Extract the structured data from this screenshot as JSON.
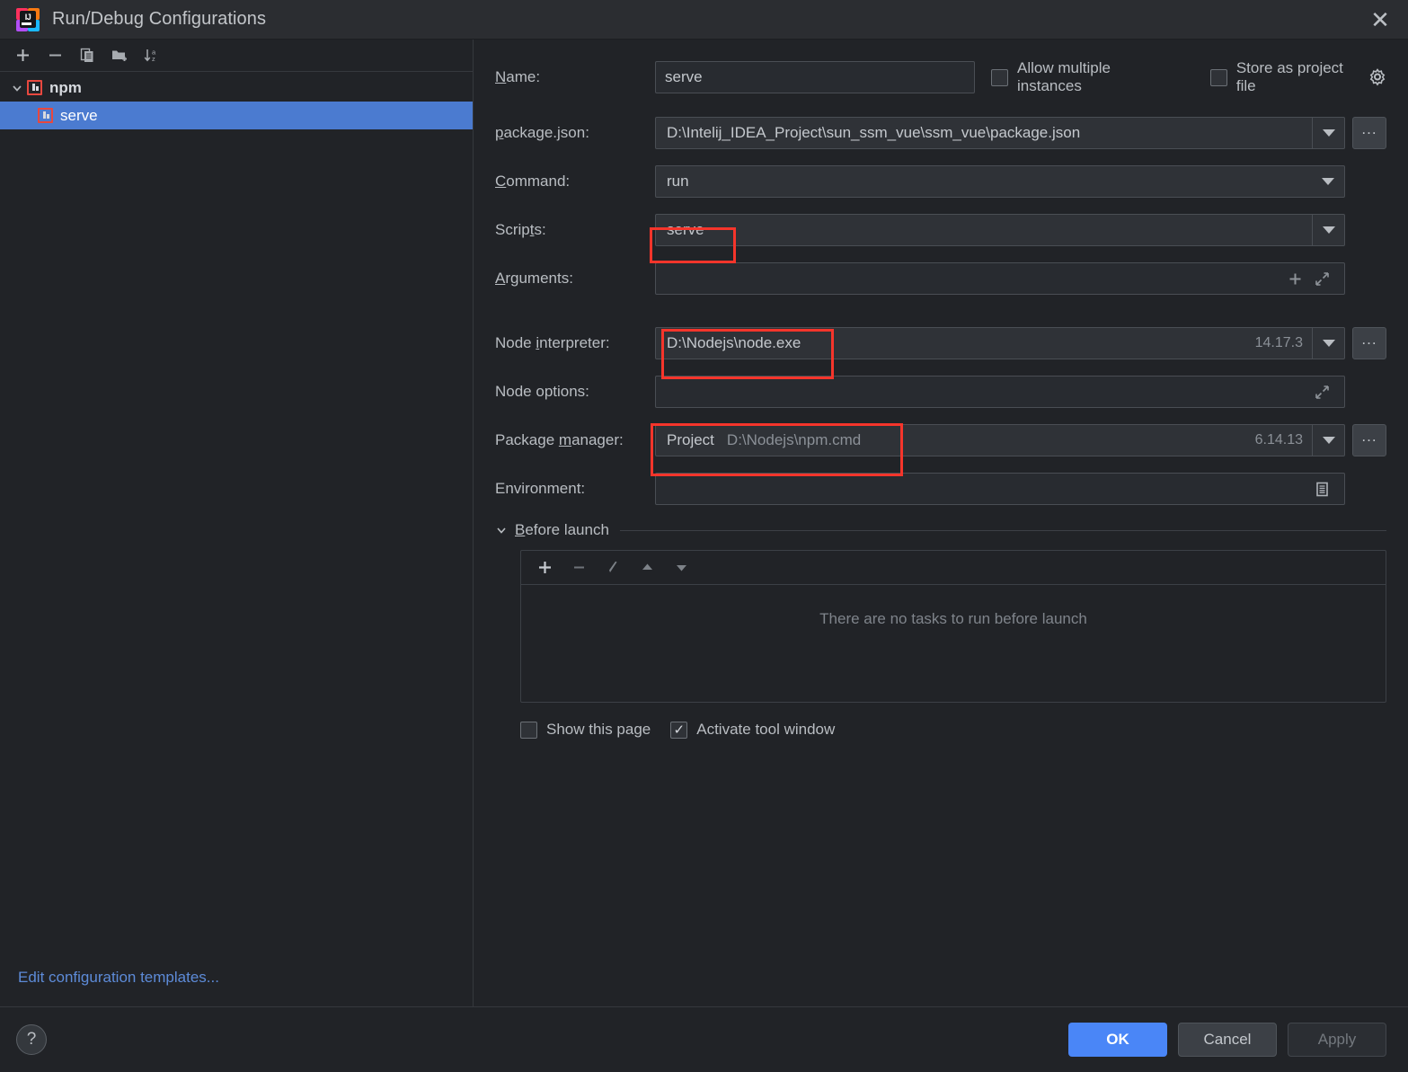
{
  "window": {
    "title": "Run/Debug Configurations",
    "logo_text": "IJ",
    "close_icon": "✕"
  },
  "sidebar": {
    "toolbar": [
      {
        "name": "add-configuration-button",
        "icon": "plus-icon"
      },
      {
        "name": "remove-configuration-button",
        "icon": "minus-icon"
      },
      {
        "name": "copy-configuration-button",
        "icon": "copy-icon"
      },
      {
        "name": "new-folder-button",
        "icon": "new-folder-icon"
      },
      {
        "name": "sort-alphabetically-button",
        "icon": "sort-az-icon"
      }
    ],
    "tree": [
      {
        "label": "npm",
        "type": "group",
        "expanded": true,
        "selected": false
      },
      {
        "label": "serve",
        "type": "item",
        "selected": true
      }
    ],
    "edit_templates_link": "Edit configuration templates..."
  },
  "form": {
    "name": {
      "label": "Name:",
      "label_mnemonic": "N",
      "value": "serve"
    },
    "allow_multiple_instances": {
      "label": "Allow multiple instances",
      "checked": false
    },
    "store_as_project_file": {
      "label": "Store as project file",
      "checked": false
    },
    "package_json": {
      "label": "package.json:",
      "value": "D:\\Intelij_IDEA_Project\\sun_ssm_vue\\ssm_vue\\package.json"
    },
    "command": {
      "label": "Command:",
      "value": "run"
    },
    "scripts": {
      "label": "Scripts:",
      "value": "serve",
      "highlighted": true
    },
    "arguments": {
      "label": "Arguments:",
      "value": ""
    },
    "node_interpreter": {
      "label": "Node interpreter:",
      "value": "D:\\Nodejs\\node.exe",
      "version": "14.17.3",
      "highlighted": true
    },
    "node_options": {
      "label": "Node options:",
      "value": ""
    },
    "package_manager": {
      "label": "Package manager:",
      "scope": "Project",
      "value": "D:\\Nodejs\\npm.cmd",
      "version": "6.14.13",
      "highlighted": true
    },
    "environment": {
      "label": "Environment:",
      "value": ""
    },
    "browse_label": "..."
  },
  "before_launch": {
    "title": "Before launch",
    "title_mnemonic": "B",
    "toolbar": [
      {
        "name": "add-task-button",
        "icon": "plus-icon"
      },
      {
        "name": "remove-task-button",
        "icon": "minus-icon"
      },
      {
        "name": "edit-task-button",
        "icon": "pencil-icon"
      },
      {
        "name": "move-task-up-button",
        "icon": "triangle-up-icon"
      },
      {
        "name": "move-task-down-button",
        "icon": "triangle-down-icon"
      }
    ],
    "empty_message": "There are no tasks to run before launch",
    "show_this_page": {
      "label": "Show this page",
      "checked": false
    },
    "activate_tool_window": {
      "label": "Activate tool window",
      "checked": true
    },
    "check_mark": "✓"
  },
  "footer": {
    "help_label": "?",
    "ok_label": "OK",
    "cancel_label": "Cancel",
    "apply_label": "Apply"
  },
  "colors": {
    "accent_blue": "#4a86f7",
    "selection_blue": "#4b7bd0",
    "annotation_red": "#f5352b",
    "link_blue": "#5d8bd8",
    "npm_icon_red": "#e8483f"
  }
}
